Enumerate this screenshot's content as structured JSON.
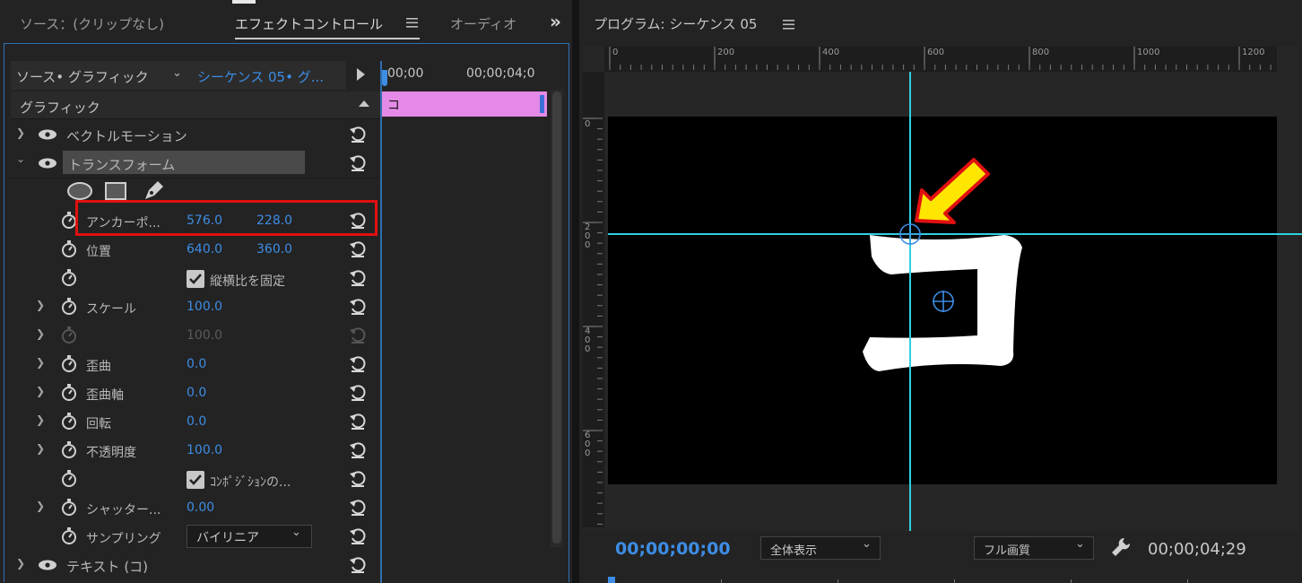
{
  "left_panel": {
    "tabs": [
      "ソース：(クリップなし)",
      "エフェクトコントロール",
      "オーディオ"
    ],
    "more_glyph": "»",
    "source_selector": "ソース• グラフィック",
    "sequence_selector": "シーケンス 05• グ...",
    "section_header": "グラフィック",
    "vector_motion": "ベクトルモーション",
    "transform": "トランスフォーム",
    "rows": {
      "anchor": {
        "label": "アンカーポ...",
        "x": "576.0",
        "y": "228.0"
      },
      "position": {
        "label": "位置",
        "x": "640.0",
        "y": "360.0"
      },
      "uniform_scale": {
        "label": "縦横比を固定"
      },
      "scale": {
        "label": "スケール",
        "value": "100.0"
      },
      "scale_width": {
        "value": "100.0"
      },
      "skew": {
        "label": "歪曲",
        "value": "0.0"
      },
      "skew_axis": {
        "label": "歪曲軸",
        "value": "0.0"
      },
      "rotation": {
        "label": "回転",
        "value": "0.0"
      },
      "opacity": {
        "label": "不透明度",
        "value": "100.0"
      },
      "comp_shutter": {
        "label": "ｺﾝﾎﾟｼﾞｼｮﾝの..."
      },
      "shutter": {
        "label": "シャッター...",
        "value": "0.00"
      },
      "sampling": {
        "label": "サンプリング",
        "value": "バイリニア"
      }
    },
    "text_layer": "テキスト (コ)",
    "timeline": {
      "t0": "00;00",
      "t1": "00;00;04;0",
      "clip_label": "コ"
    }
  },
  "program": {
    "title": "プログラム: シーケンス 05",
    "ruler_h": [
      "0",
      "200",
      "400",
      "600",
      "800",
      "1000",
      "1200"
    ],
    "ruler_v": [
      "0",
      "200",
      "400",
      "600"
    ],
    "glyph": "コ",
    "timecode_current": "00;00;00;00",
    "zoom": "全体表示",
    "quality": "フル画質",
    "timecode_duration": "00;00;04;29"
  },
  "colors": {
    "accent_blue": "#3d8de5",
    "highlight_red": "#e01010",
    "clip_pink": "#e48ae6",
    "guide_cyan": "#2fd0e0",
    "arrow_yellow": "#ffe600"
  }
}
